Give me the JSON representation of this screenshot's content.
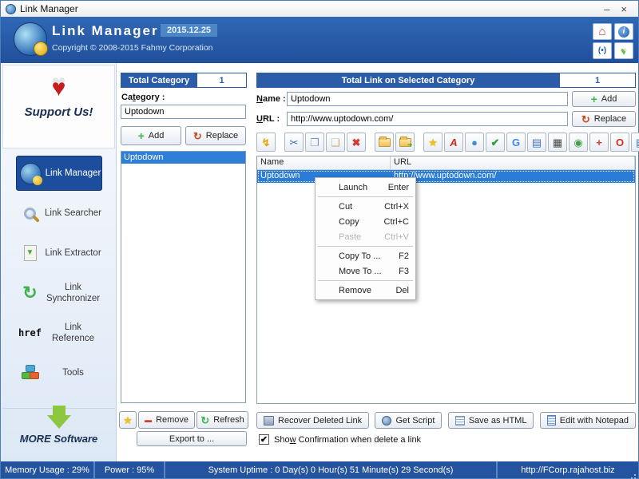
{
  "window": {
    "title": "Link Manager",
    "minimize": "–",
    "close": "×"
  },
  "header": {
    "app_name": "Link Manager",
    "version": "2015.12.25",
    "copyright": "Copyright © 2008-2015 Fahmy Corporation"
  },
  "sidebar": {
    "support_label": "Support Us!",
    "items": [
      {
        "label": "Link Manager"
      },
      {
        "label": "Link Searcher"
      },
      {
        "label": "Link Extractor"
      },
      {
        "label": "Link Synchronizer"
      },
      {
        "label": "Link Reference"
      },
      {
        "label": "Tools"
      }
    ],
    "more_label": "MORE Software"
  },
  "category_panel": {
    "header": "Total Category",
    "count": "1",
    "label": {
      "pre": "Ca",
      "key": "t",
      "post": "egory :"
    },
    "input_value": "Uptodown",
    "add": "Add",
    "replace": "Replace",
    "list": [
      "Uptodown"
    ],
    "remove": "Remove",
    "refresh": "Refresh",
    "export": "Export to ..."
  },
  "link_panel": {
    "header": "Total Link on Selected Category",
    "count": "1",
    "name_label": {
      "key": "N",
      "post": "ame :"
    },
    "name_value": "Uptodown",
    "url_label": {
      "key": "U",
      "post": "RL :"
    },
    "url_value": "http://www.uptodown.com/",
    "add": "Add",
    "replace": "Replace",
    "table": {
      "columns": [
        "Name",
        "URL"
      ],
      "rows": [
        {
          "name": "Uptodown",
          "url": "http://www.uptodown.com/"
        }
      ]
    },
    "buttons": {
      "recover": "Recover Deleted Link",
      "get_script": "Get Script",
      "save_html": "Save as HTML",
      "edit_notepad": "Edit with Notepad"
    },
    "checkbox": {
      "pre": "Sho",
      "key": "w",
      "post": " Confirmation when delete a link",
      "checked": true
    }
  },
  "context_menu": {
    "items": [
      {
        "label": "Launch",
        "shortcut": "Enter"
      },
      {
        "label": "Cut",
        "shortcut": "Ctrl+X"
      },
      {
        "label": "Copy",
        "shortcut": "Ctrl+C"
      },
      {
        "label": "Paste",
        "shortcut": "Ctrl+V",
        "disabled": true
      },
      {
        "label": "Copy To ...",
        "shortcut": "F2"
      },
      {
        "label": "Move To ...",
        "shortcut": "F3"
      },
      {
        "label": "Remove",
        "shortcut": "Del"
      }
    ]
  },
  "statusbar": {
    "memory": "Memory Usage : 29%",
    "power": "Power : 95%",
    "uptime": "System Uptime : 0 Day(s) 0 Hour(s) 51 Minute(s) 29 Second(s)",
    "url": "http://FCorp.rajahost.biz"
  },
  "icons": {
    "home": "⌂",
    "info": "i",
    "signal": "(•)",
    "heart": "♥",
    "tiny_plus": "+",
    "lightning": "↯",
    "cut": "✂",
    "copy": "❐",
    "paste": "❏",
    "delete": "✖",
    "star": "★",
    "pdf": "A",
    "ball": "●",
    "check": "✔",
    "google": "G",
    "doc": "▤",
    "qr": "▦",
    "globe": "◉",
    "plus": "+",
    "opera": "O",
    "notes": "▤",
    "replace_arrows": "↻",
    "refresh_arrows": "↻",
    "remove_bar": "▬",
    "checkmark": "✔"
  },
  "colors": {
    "header_blue": "#2b5fae",
    "accent_blue": "#1d4e9e",
    "selection_blue": "#2a7cd8",
    "status_blue": "#24549f",
    "green": "#3db54a"
  }
}
